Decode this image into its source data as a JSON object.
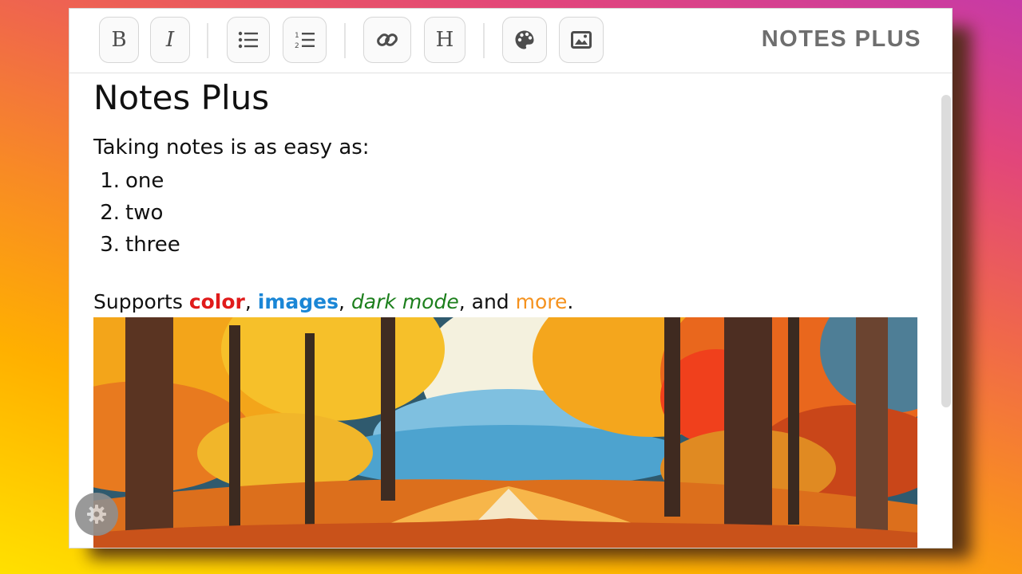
{
  "toolbar": {
    "bold_label": "B",
    "italic_label": "I",
    "heading_label": "H",
    "brand": "NOTES PLUS",
    "icons": [
      "bold-icon",
      "italic-icon",
      "bullet-list-icon",
      "numbered-list-icon",
      "link-icon",
      "heading-icon",
      "palette-icon",
      "image-icon"
    ]
  },
  "document": {
    "title": "Notes Plus",
    "intro": "Taking notes is as easy as:",
    "steps": [
      {
        "num": "1.",
        "text": "one"
      },
      {
        "num": "2.",
        "text": "two"
      },
      {
        "num": "3.",
        "text": "three"
      }
    ],
    "supports": {
      "prefix": "Supports ",
      "color": "color",
      "sep1": ", ",
      "images": "images",
      "sep2": ", ",
      "dark_mode": "dark mode",
      "sep3": ", and ",
      "more": "more",
      "suffix": "."
    }
  },
  "colors": {
    "color_word": "#e01b1b",
    "images_word": "#1a86d6",
    "dark_mode_word": "#1c7f1c",
    "more_word": "#f5921e"
  },
  "settings": {
    "icon": "gear-icon"
  }
}
